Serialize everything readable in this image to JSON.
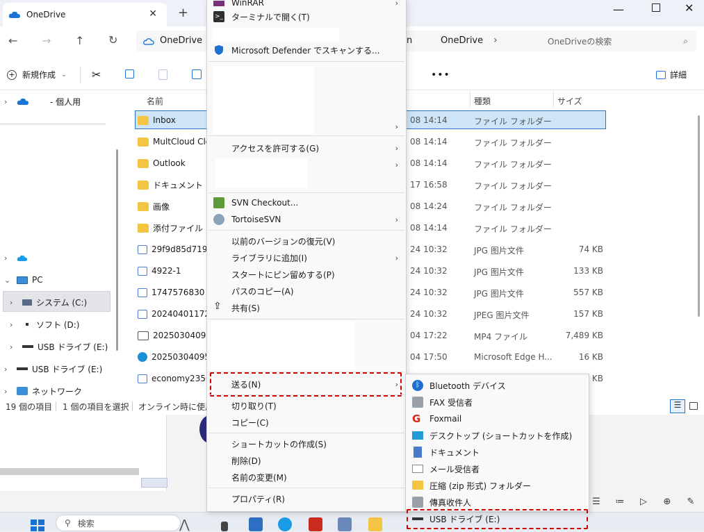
{
  "window": {
    "tab_title": "OneDrive",
    "close": "✕",
    "new_tab": "+",
    "minimize": "—",
    "close_window": "✕"
  },
  "nav": {
    "back": "←",
    "forward": "→",
    "up": "↑",
    "refresh": "↻",
    "addr_first": "OneDrive",
    "addr_chevron": "›",
    "addr_fragment": "n",
    "addr_last": "OneDrive",
    "addr_last_chevron": "›",
    "search_placeholder": "OneDriveの検索",
    "search_icon": "⌕"
  },
  "command_bar": {
    "new_label": "新規作成",
    "new_chevron": "⌄",
    "more": "•••",
    "details_label": "詳細"
  },
  "sidebar": {
    "items": [
      {
        "label": "- 個人用"
      },
      {
        "label": ""
      },
      {
        "label": "PC"
      },
      {
        "label": "システム (C:)"
      },
      {
        "label": "ソフト (D:)"
      },
      {
        "label": "USB ドライブ (E:)"
      },
      {
        "label": "USB ドライブ (E:)"
      },
      {
        "label": "ネットワーク"
      }
    ]
  },
  "file_list": {
    "headers": {
      "name": "名前",
      "type": "種類",
      "size": "サイズ"
    },
    "rows": [
      {
        "name": "Inbox",
        "date": "08 14:14",
        "type": "ファイル フォルダー",
        "size": ""
      },
      {
        "name": "MultCloud Clou",
        "date": "08 14:14",
        "type": "ファイル フォルダー",
        "size": ""
      },
      {
        "name": "Outlook",
        "date": "08 14:14",
        "type": "ファイル フォルダー",
        "size": ""
      },
      {
        "name": "ドキュメント",
        "date": "17 16:58",
        "type": "ファイル フォルダー",
        "size": ""
      },
      {
        "name": "画像",
        "date": "08 14:24",
        "type": "ファイル フォルダー",
        "size": ""
      },
      {
        "name": "添付ファイル",
        "date": "08 14:14",
        "type": "ファイル フォルダー",
        "size": ""
      },
      {
        "name": "29f9d85d719a8",
        "date": "24 10:32",
        "type": "JPG 图片文件",
        "size": "74 KB"
      },
      {
        "name": "4922-1",
        "date": "24 10:32",
        "type": "JPG 图片文件",
        "size": "133 KB"
      },
      {
        "name": "1747576830",
        "date": "24 10:32",
        "type": "JPG 图片文件",
        "size": "557 KB"
      },
      {
        "name": "2024040117231",
        "date": "24 10:32",
        "type": "JPEG 图片文件",
        "size": "157 KB"
      },
      {
        "name": "2025030409220",
        "date": "04 17:22",
        "type": "MP4 ファイル",
        "size": "7,489 KB"
      },
      {
        "name": "2025030409504",
        "date": "04 17:50",
        "type": "Microsoft Edge H...",
        "size": "16 KB"
      },
      {
        "name": "economy2350_",
        "date": "",
        "type": "",
        "size": "5 KB"
      }
    ]
  },
  "status_bar": {
    "count": "19 個の項目",
    "selected": "1 個の項目を選択",
    "online": "オンライン時に使用可"
  },
  "context_menu": {
    "items": [
      {
        "label": "WinRAR"
      },
      {
        "label": "ターミナルで開く(T)"
      },
      {
        "label": "Microsoft Defender でスキャンする..."
      },
      {
        "label": ""
      },
      {
        "label": "アクセスを許可する(G)"
      },
      {
        "label": ""
      },
      {
        "label": "SVN Checkout..."
      },
      {
        "label": "TortoiseSVN"
      },
      {
        "label": "以前のバージョンの復元(V)"
      },
      {
        "label": "ライブラリに追加(I)"
      },
      {
        "label": "スタートにピン留めする(P)"
      },
      {
        "label": "パスのコピー(A)"
      },
      {
        "label": "共有(S)"
      },
      {
        "label": "送る(N)"
      },
      {
        "label": "切り取り(T)"
      },
      {
        "label": "コピー(C)"
      },
      {
        "label": "ショートカットの作成(S)"
      },
      {
        "label": "削除(D)"
      },
      {
        "label": "名前の変更(M)"
      },
      {
        "label": "プロパティ(R)"
      }
    ],
    "submenu_arrow": "›"
  },
  "send_to_menu": {
    "items": [
      {
        "label": "Bluetooth デバイス"
      },
      {
        "label": "FAX 受信者"
      },
      {
        "label": "Foxmail"
      },
      {
        "label": "デスクトップ (ショートカットを作成)"
      },
      {
        "label": "ドキュメント"
      },
      {
        "label": "メール受信者"
      },
      {
        "label": "圧縮 (zip 形式) フォルダー"
      },
      {
        "label": "傳真收件人"
      },
      {
        "label": "USB ドライブ (E:)"
      }
    ]
  },
  "taskbar": {
    "search_placeholder": "検索"
  },
  "colors": {
    "accent": "#2b73c9",
    "selection": "#cde5f7",
    "highlight_dashed": "#d10000",
    "folder": "#f4c542"
  }
}
